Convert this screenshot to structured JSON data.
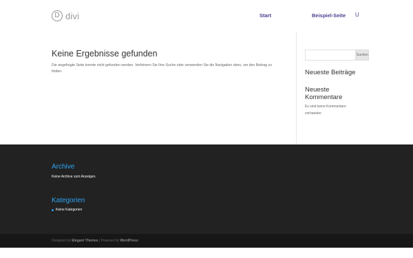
{
  "header": {
    "logo_mark": "D",
    "logo_text": "divi",
    "nav": [
      {
        "label": "Start"
      },
      {
        "label": "Beispiel-Seite"
      }
    ],
    "search_icon_glyph": "U"
  },
  "main": {
    "title": "Keine Ergebnisse gefunden",
    "message": "Die angefragte Seite konnte nicht gefunden werden. Verfeinern Sie Ihre Suche oder verwenden Sie die Navigation oben, um den Beitrag zu finden."
  },
  "sidebar": {
    "search_placeholder": "",
    "search_button": "Suchen",
    "widget1_title": "Neueste Beiträge",
    "widget2_title": "Neueste Kommentare",
    "widget2_text": "Es sind keine Kommentare vorhanden"
  },
  "footer": {
    "archive_title": "Archive",
    "archive_text": "Keine Archive zum Anzeigen.",
    "categories_title": "Kategorien",
    "categories_item": "Keine Kategorien",
    "credits_prefix": "Designed by ",
    "credits_theme": "Elegant Themes",
    "credits_mid": " | Powered by ",
    "credits_wp": "WordPress"
  },
  "colors": {
    "accent": "#2ea3f2",
    "nav": "#4a3f8f",
    "footer_bg": "#222222",
    "bottom_bar_bg": "#171717"
  }
}
